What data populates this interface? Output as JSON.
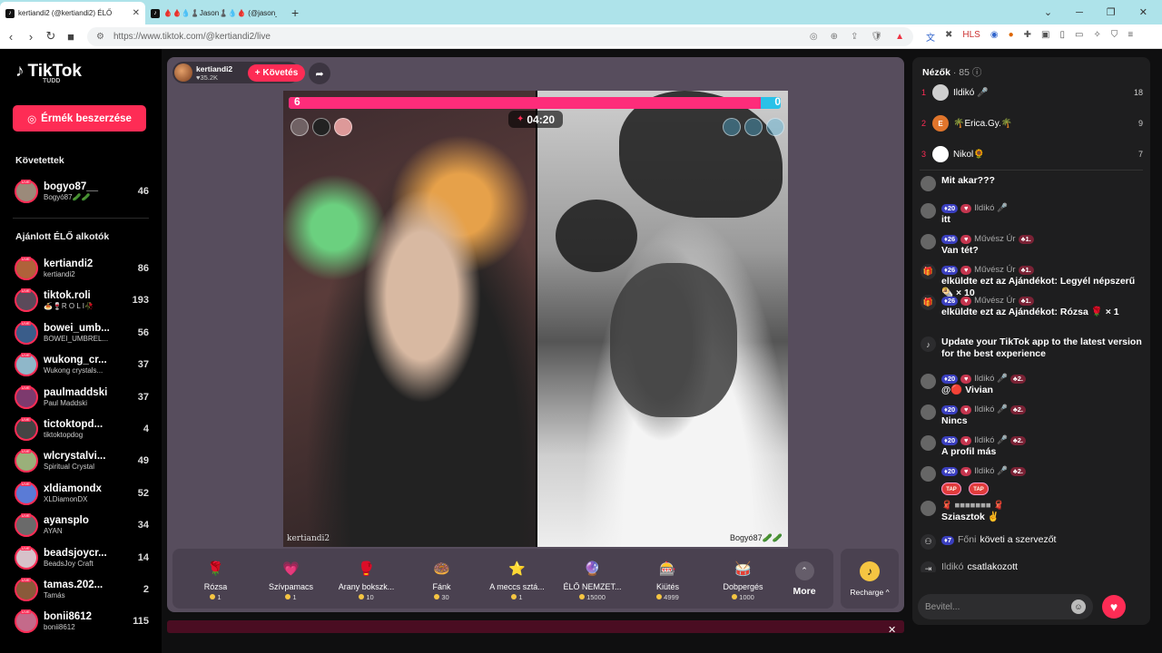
{
  "browser": {
    "tabs": [
      {
        "title": "kertiandi2 (@kertiandi2) ÉLŐ",
        "active": true
      },
      {
        "title": "🩸🩸💧♟️Jason♟️💧🩸 (@jason_sen",
        "active": false
      }
    ],
    "url": "https://www.tiktok.com/@kertiandi2/live"
  },
  "sidebar": {
    "logo": "TikTok",
    "logo_sub": "TUDD",
    "coins_button": "Érmék beszerzése",
    "following_title": "Követettek",
    "following": [
      {
        "name": "bogyo87__",
        "handle": "Bogyó87🥒🥒",
        "count": "46"
      }
    ],
    "suggested_title": "Ajánlott ÉLŐ alkotók",
    "suggested": [
      {
        "name": "kertiandi2",
        "handle": "kertiandi2",
        "count": "86",
        "color": "#b0623a"
      },
      {
        "name": "tiktok.roli",
        "handle": "🍝🍷R O L I🥀",
        "count": "193",
        "color": "#5a4a5a"
      },
      {
        "name": "bowei_umb...",
        "handle": "BOWEI_UMBREL...",
        "count": "56",
        "color": "#3a5d8a"
      },
      {
        "name": "wukong_cr...",
        "handle": "Wukong crystals...",
        "count": "37",
        "color": "#8fb7c9"
      },
      {
        "name": "paulmaddski",
        "handle": "Paul Maddski",
        "count": "37",
        "color": "#7d3a6e"
      },
      {
        "name": "tictoktopd...",
        "handle": "tiktoktopdog",
        "count": "4",
        "color": "#444"
      },
      {
        "name": "wlcrystalvi...",
        "handle": "Spiritual Crystal",
        "count": "49",
        "color": "#9ab07a"
      },
      {
        "name": "xldiamondx",
        "handle": "XLDiamonDX",
        "count": "52",
        "color": "#5a7bd6"
      },
      {
        "name": "ayansplo",
        "handle": "AYAN",
        "count": "34",
        "color": "#6a6a6a"
      },
      {
        "name": "beadsjoycr...",
        "handle": "BeadsJoy Craft",
        "count": "14",
        "color": "#d6c1c9"
      },
      {
        "name": "tamas.202...",
        "handle": "Tamás",
        "count": "2",
        "color": "#8a5a3a"
      },
      {
        "name": "bonii8612",
        "handle": "bonii8612",
        "count": "115",
        "color": "#c46a8a"
      }
    ]
  },
  "stream": {
    "host_name": "kertiandi2",
    "host_likes": "♥35.2K",
    "follow_button": "+ Követés",
    "battle": {
      "left_score": "6",
      "right_score": "0",
      "timer": "04:20"
    },
    "left_label": "kertiandi2",
    "right_label": "Bogyó87🥒🥒"
  },
  "gifts": [
    {
      "name": "Rózsa",
      "price": "1",
      "icon": "🌹"
    },
    {
      "name": "Szívpamacs",
      "price": "1",
      "icon": "💗"
    },
    {
      "name": "Arany bokszk...",
      "price": "10",
      "icon": "🥊"
    },
    {
      "name": "Fánk",
      "price": "30",
      "icon": "🍩"
    },
    {
      "name": "A meccs sztá...",
      "price": "1",
      "icon": "⭐"
    },
    {
      "name": "ÉLŐ NEMZET...",
      "price": "15000",
      "icon": "🔮"
    },
    {
      "name": "Kiütés",
      "price": "4999",
      "icon": "🎰"
    },
    {
      "name": "Dobpergés",
      "price": "1000",
      "icon": "🥁"
    }
  ],
  "more_label": "More",
  "recharge_label": "Recharge ^",
  "viewers": {
    "title": "Nézők",
    "count": "· 85",
    "top": [
      {
        "rank": "1",
        "name": "Ildikó 🎤",
        "score": "18",
        "color": "#cfcfcf",
        "letter": ""
      },
      {
        "rank": "2",
        "name": "🌴Erica.Gy.🌴",
        "score": "9",
        "color": "#e0752c",
        "letter": "E"
      },
      {
        "rank": "3",
        "name": "Nikol🌻",
        "score": "7",
        "color": "#fff",
        "letter": ""
      }
    ]
  },
  "chat": [
    {
      "user": "",
      "lvl": "",
      "text": "Mit akar???",
      "type": "plain"
    },
    {
      "user": "Ildikó 🎤",
      "lvl": "20",
      "text": "itt",
      "type": "user"
    },
    {
      "user": "Művész Úr",
      "lvl": "26",
      "text": "Van tét?",
      "type": "user",
      "rank": "1."
    },
    {
      "user": "Művész Úr",
      "lvl": "26",
      "text": "elküldte ezt az Ajándékot: Legyél népszerű 🌯 × 10",
      "type": "gift",
      "rank": "1."
    },
    {
      "user": "Művész Úr",
      "lvl": "26",
      "text": "elküldte ezt az Ajándékot: Rózsa 🌹 × 1",
      "type": "gift",
      "rank": "1."
    },
    {
      "user": "",
      "lvl": "",
      "text": "Update your TikTok app to the latest version for the best experience",
      "type": "system"
    },
    {
      "user": "Ildikó 🎤",
      "lvl": "20",
      "text": "@🔴 Vivian",
      "type": "user",
      "rank": "2."
    },
    {
      "user": "Ildikó 🎤",
      "lvl": "20",
      "text": "Nincs",
      "type": "user",
      "rank": "2."
    },
    {
      "user": "Ildikó 🎤",
      "lvl": "20",
      "text": "A profil más",
      "type": "user",
      "rank": "2."
    },
    {
      "user": "Ildikó 🎤",
      "lvl": "20",
      "text": "",
      "type": "tap",
      "rank": "2."
    },
    {
      "user": "🧣 ■■■■■■■ 🧣",
      "lvl": "",
      "text": "Sziasztok ✌️",
      "type": "user"
    },
    {
      "user": "Főni",
      "lvl": "7",
      "text": "követi a szervezőt",
      "type": "follow"
    },
    {
      "user": "Ildikó",
      "lvl": "",
      "text": "csatlakozott",
      "type": "join"
    }
  ],
  "chat_input_placeholder": "Bevitel...",
  "tap_label": "TAP"
}
